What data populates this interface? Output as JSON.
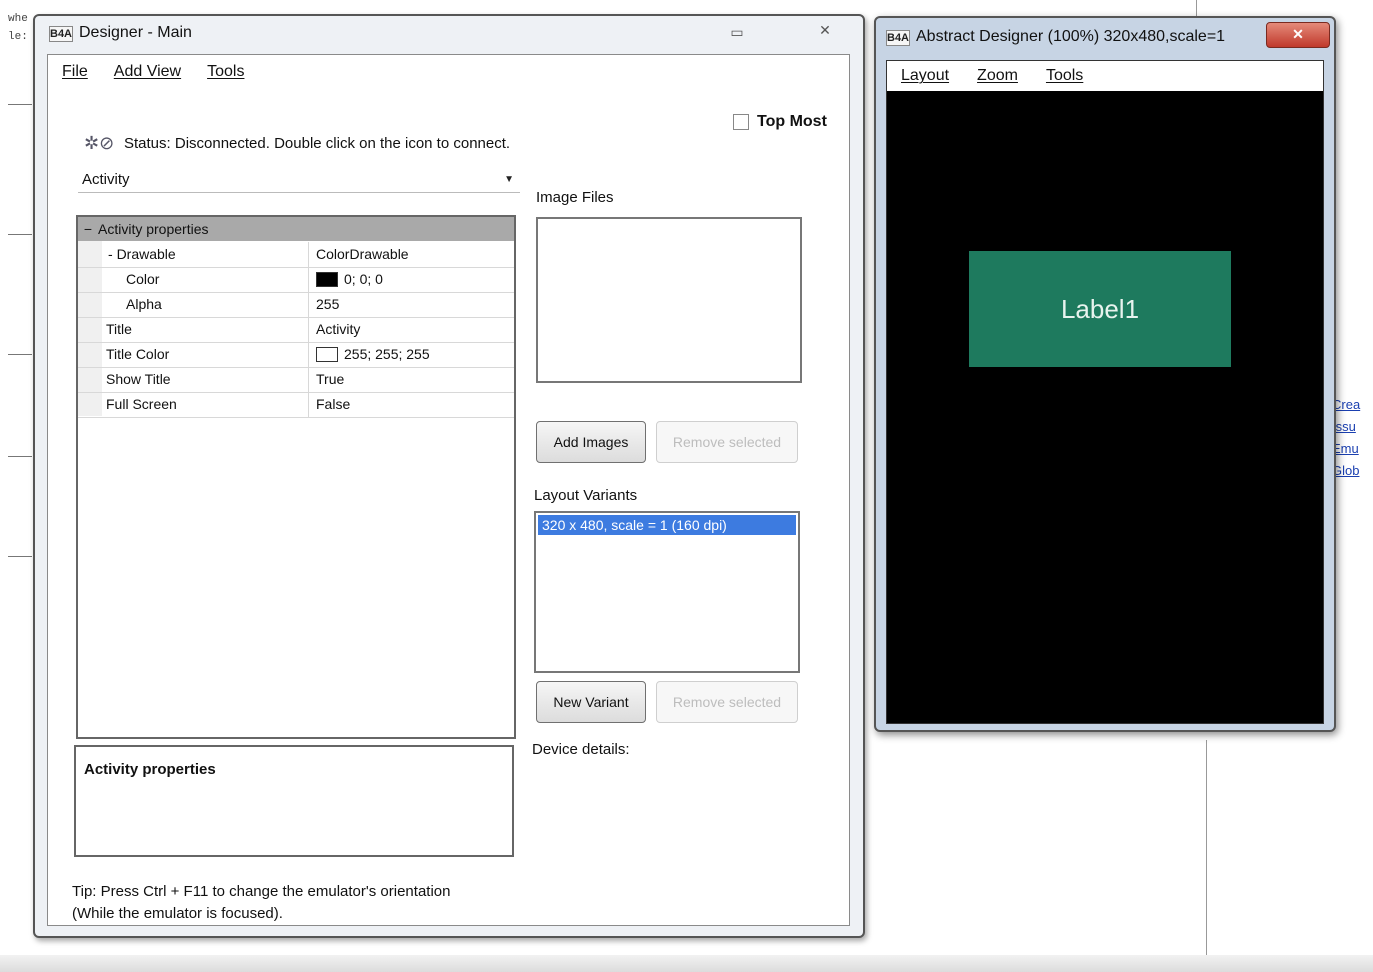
{
  "background": {
    "code_lines": [
      "whe",
      "le:"
    ]
  },
  "main_window": {
    "title": "Designer - Main",
    "icon_text": "B4A",
    "menu": [
      {
        "label": "File"
      },
      {
        "label": "Add View"
      },
      {
        "label": "Tools"
      }
    ],
    "status_text": "Status: Disconnected. Double click on the icon to connect.",
    "topmost_label": "Top Most",
    "topmost_checked": false,
    "combo_value": "Activity",
    "property_grid": {
      "header": "Activity properties",
      "rows": [
        {
          "name": "Drawable",
          "value": "ColorDrawable",
          "indent": 1,
          "toggle": "-"
        },
        {
          "name": "Color",
          "value": "0; 0; 0",
          "indent": 2,
          "swatch": "#000000"
        },
        {
          "name": "Alpha",
          "value": "255",
          "indent": 2
        },
        {
          "name": "Title",
          "value": "Activity",
          "indent": 0
        },
        {
          "name": "Title Color",
          "value": "255; 255; 255",
          "indent": 0,
          "swatch": "#ffffff"
        },
        {
          "name": "Show Title",
          "value": "True",
          "indent": 0
        },
        {
          "name": "Full Screen",
          "value": "False",
          "indent": 0
        }
      ]
    },
    "description_title": "Activity properties",
    "tip_line1": "Tip: Press Ctrl + F11 to change the emulator's orientation",
    "tip_line2": "(While the emulator is focused).",
    "image_files_label": "Image Files",
    "add_images_label": "Add Images",
    "remove_images_label": "Remove selected",
    "layout_variants_label": "Layout Variants",
    "layout_variants": [
      "320 x 480, scale = 1 (160 dpi)"
    ],
    "new_variant_label": "New Variant",
    "remove_variant_label": "Remove selected",
    "device_details_label": "Device details:"
  },
  "abstract_window": {
    "title": "Abstract Designer (100%) 320x480,scale=1",
    "icon_text": "B4A",
    "menu": [
      {
        "label": "Layout"
      },
      {
        "label": "Zoom"
      },
      {
        "label": "Tools"
      }
    ],
    "label_view_text": "Label1",
    "label_view_color": "#1e7a5e"
  }
}
